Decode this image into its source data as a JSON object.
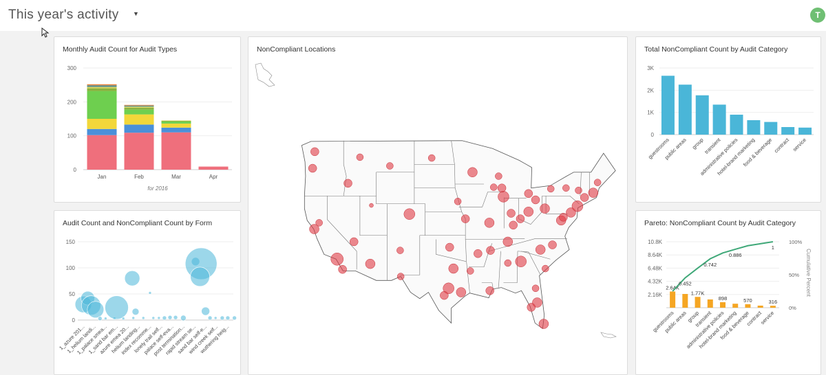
{
  "header": {
    "title": "This year's activity",
    "avatar_initial": "T"
  },
  "colors": {
    "pink": "#ef6f7c",
    "blue": "#4a90d9",
    "yellow": "#f2d73a",
    "green": "#6ecf4f",
    "olive": "#8bb23f",
    "orange_top": "#e8823a",
    "teal": "#4ab6d8",
    "pareto_bar": "#f5a623",
    "pareto_line": "#3fa878",
    "map_point": "#df3a44"
  },
  "cards": {
    "monthly": {
      "title": "Monthly Audit Count for Audit Types"
    },
    "map": {
      "title": "NonCompliant Locations"
    },
    "total": {
      "title": "Total NonCompliant Count by Audit Category"
    },
    "form": {
      "title": "Audit Count and NonCompliant Count by Form"
    },
    "pareto": {
      "title": "Pareto: NonCompliant Count by Audit Category"
    }
  },
  "chart_data": [
    {
      "id": "monthly",
      "type": "bar",
      "stacked": true,
      "categories": [
        "Jan",
        "Feb",
        "Mar",
        "Apr"
      ],
      "xlabel": "for 2016",
      "ylim": [
        0,
        300
      ],
      "yticks": [
        "0",
        "100",
        "200",
        "300"
      ],
      "grid": true,
      "series": [
        {
          "color": "#ef6f7c",
          "values": [
            102,
            109,
            110,
            9
          ]
        },
        {
          "color": "#4a90d9",
          "values": [
            18,
            24,
            14,
            0
          ]
        },
        {
          "color": "#f2d73a",
          "values": [
            30,
            30,
            12,
            0
          ]
        },
        {
          "color": "#6ecf4f",
          "values": [
            82,
            14,
            6,
            0
          ]
        },
        {
          "color": "#8bb23f",
          "values": [
            8,
            6,
            2,
            0
          ]
        },
        {
          "color": "#d8d45a",
          "values": [
            4,
            3,
            1,
            0
          ]
        },
        {
          "color": "#5a8f8f",
          "values": [
            5,
            3,
            0,
            0
          ]
        },
        {
          "color": "#e8823a",
          "values": [
            3,
            2,
            0,
            0
          ]
        }
      ]
    },
    {
      "id": "total",
      "type": "bar",
      "categories": [
        "guestrooms",
        "public areas",
        "group",
        "transient",
        "administrative policies",
        "hotel-brand marketing",
        "food & beverage",
        "contract",
        "service"
      ],
      "values": [
        2650,
        2250,
        1770,
        1350,
        898,
        650,
        570,
        340,
        316
      ],
      "ylim": [
        0,
        3000
      ],
      "yticks": [
        "0",
        "1K",
        "2K",
        "3K"
      ],
      "grid": true,
      "color": "#4ab6d8"
    },
    {
      "id": "form",
      "type": "scatter",
      "subtype": "bubble",
      "categories": [
        "1_azure 201...",
        "1_helium landi...",
        "1_palace smea...",
        "1_sand bar em...",
        "azure emea 20...",
        "helium landing...",
        "index recomme...",
        "lonely trail self...",
        "palace self-eva...",
        "post termination...",
        "rapid stream se...",
        "sand bar self-e...",
        "wind creek self...",
        "wuthering heig..."
      ],
      "ylim": [
        0,
        150
      ],
      "yticks": [
        "0",
        "50",
        "100",
        "150"
      ],
      "grid": true,
      "color": "#4ab6d8",
      "points": [
        {
          "x": 0.0,
          "y": 30,
          "r": 12
        },
        {
          "x": 0.4,
          "y": 42,
          "r": 10
        },
        {
          "x": 0.7,
          "y": 28,
          "r": 14
        },
        {
          "x": 1.1,
          "y": 20,
          "r": 12
        },
        {
          "x": 1.5,
          "y": 3,
          "r": 3
        },
        {
          "x": 2.0,
          "y": 3,
          "r": 2
        },
        {
          "x": 2.8,
          "y": 3,
          "r": 2
        },
        {
          "x": 3.0,
          "y": 24,
          "r": 17
        },
        {
          "x": 3.6,
          "y": 3,
          "r": 2
        },
        {
          "x": 4.4,
          "y": 80,
          "r": 11
        },
        {
          "x": 4.5,
          "y": 4,
          "r": 2
        },
        {
          "x": 4.7,
          "y": 16,
          "r": 5
        },
        {
          "x": 5.4,
          "y": 4,
          "r": 2
        },
        {
          "x": 6.0,
          "y": 52,
          "r": 2
        },
        {
          "x": 6.3,
          "y": 4,
          "r": 2
        },
        {
          "x": 6.8,
          "y": 4,
          "r": 2
        },
        {
          "x": 7.3,
          "y": 4,
          "r": 3
        },
        {
          "x": 7.8,
          "y": 5,
          "r": 3
        },
        {
          "x": 8.3,
          "y": 5,
          "r": 3
        },
        {
          "x": 9.0,
          "y": 4,
          "r": 4
        },
        {
          "x": 10.1,
          "y": 112,
          "r": 6
        },
        {
          "x": 10.6,
          "y": 108,
          "r": 23
        },
        {
          "x": 10.5,
          "y": 83,
          "r": 14
        },
        {
          "x": 11.0,
          "y": 17,
          "r": 6
        },
        {
          "x": 11.4,
          "y": 4,
          "r": 3
        },
        {
          "x": 11.9,
          "y": 4,
          "r": 2
        },
        {
          "x": 12.5,
          "y": 4,
          "r": 3
        },
        {
          "x": 13.0,
          "y": 4,
          "r": 3
        },
        {
          "x": 13.6,
          "y": 4,
          "r": 3
        }
      ]
    },
    {
      "id": "pareto",
      "type": "bar",
      "categories": [
        "guestrooms",
        "public areas",
        "group",
        "transient",
        "administrative policies",
        "hotel-brand marketing",
        "food & beverage",
        "contract",
        "service"
      ],
      "values": [
        2650,
        2250,
        1770,
        1350,
        898,
        650,
        570,
        340,
        316
      ],
      "bar_labels": [
        "2.64K",
        "",
        "1.77K",
        "",
        "898",
        "",
        "570",
        "",
        "316"
      ],
      "cumulative_percent": [
        0.25,
        0.452,
        0.6,
        0.742,
        0.83,
        0.886,
        0.94,
        0.97,
        1
      ],
      "cumulative_labels": [
        "",
        "0.452",
        "",
        "0.742",
        "",
        "0.886",
        "",
        "",
        "1"
      ],
      "ylim": [
        0,
        10800
      ],
      "yticks": [
        "2.16K",
        "4.32K",
        "6.48K",
        "8.64K",
        "10.8K"
      ],
      "y2ticks": [
        "0%",
        "50%",
        "100%"
      ],
      "y2label": "Cumulative Percent",
      "grid": true,
      "bar_color": "#f5a623",
      "line_color": "#3fa878"
    },
    {
      "id": "map",
      "type": "scatter",
      "subtype": "geo-points",
      "points": [
        {
          "lon": -122.4,
          "lat": 37.8,
          "r": 7
        },
        {
          "lon": -121.5,
          "lat": 38.6,
          "r": 5
        },
        {
          "lon": -118.2,
          "lat": 34.0,
          "r": 9
        },
        {
          "lon": -117.2,
          "lat": 32.7,
          "r": 6
        },
        {
          "lon": -122.7,
          "lat": 45.5,
          "r": 6
        },
        {
          "lon": -122.3,
          "lat": 47.6,
          "r": 6
        },
        {
          "lon": -116.2,
          "lat": 43.6,
          "r": 6
        },
        {
          "lon": -115.1,
          "lat": 36.2,
          "r": 6
        },
        {
          "lon": -112.1,
          "lat": 33.4,
          "r": 7
        },
        {
          "lon": -111.9,
          "lat": 40.8,
          "r": 3
        },
        {
          "lon": -104.9,
          "lat": 39.7,
          "r": 8
        },
        {
          "lon": -106.6,
          "lat": 35.1,
          "r": 5
        },
        {
          "lon": -97.7,
          "lat": 30.3,
          "r": 8
        },
        {
          "lon": -96.8,
          "lat": 32.8,
          "r": 7
        },
        {
          "lon": -95.4,
          "lat": 29.8,
          "r": 7
        },
        {
          "lon": -98.5,
          "lat": 29.4,
          "r": 6
        },
        {
          "lon": -97.5,
          "lat": 35.5,
          "r": 6
        },
        {
          "lon": -94.6,
          "lat": 39.1,
          "r": 6
        },
        {
          "lon": -90.2,
          "lat": 38.6,
          "r": 7
        },
        {
          "lon": -93.3,
          "lat": 45.0,
          "r": 7
        },
        {
          "lon": -87.6,
          "lat": 41.9,
          "r": 8
        },
        {
          "lon": -86.2,
          "lat": 39.8,
          "r": 6
        },
        {
          "lon": -84.5,
          "lat": 39.1,
          "r": 6
        },
        {
          "lon": -83.0,
          "lat": 42.3,
          "r": 6
        },
        {
          "lon": -81.7,
          "lat": 41.5,
          "r": 6
        },
        {
          "lon": -80.0,
          "lat": 40.4,
          "r": 7
        },
        {
          "lon": -77.0,
          "lat": 38.9,
          "r": 7
        },
        {
          "lon": -75.2,
          "lat": 39.9,
          "r": 7
        },
        {
          "lon": -74.0,
          "lat": 40.7,
          "r": 8
        },
        {
          "lon": -71.1,
          "lat": 42.4,
          "r": 7
        },
        {
          "lon": -73.8,
          "lat": 42.7,
          "r": 5
        },
        {
          "lon": -76.6,
          "lat": 39.3,
          "r": 6
        },
        {
          "lon": -80.8,
          "lat": 35.2,
          "r": 7
        },
        {
          "lon": -78.6,
          "lat": 35.8,
          "r": 6
        },
        {
          "lon": -84.4,
          "lat": 33.7,
          "r": 8
        },
        {
          "lon": -86.8,
          "lat": 36.2,
          "r": 7
        },
        {
          "lon": -90.0,
          "lat": 35.1,
          "r": 6
        },
        {
          "lon": -90.1,
          "lat": 30.0,
          "r": 6
        },
        {
          "lon": -86.8,
          "lat": 33.5,
          "r": 5
        },
        {
          "lon": -81.4,
          "lat": 28.5,
          "r": 7
        },
        {
          "lon": -80.2,
          "lat": 25.8,
          "r": 7
        },
        {
          "lon": -82.5,
          "lat": 27.9,
          "r": 6
        },
        {
          "lon": -81.7,
          "lat": 30.3,
          "r": 5
        },
        {
          "lon": -79.9,
          "lat": 32.8,
          "r": 5
        },
        {
          "lon": -85.8,
          "lat": 38.3,
          "r": 6
        },
        {
          "lon": -89.4,
          "lat": 43.1,
          "r": 5
        },
        {
          "lon": -87.9,
          "lat": 43.0,
          "r": 6
        },
        {
          "lon": -96.0,
          "lat": 41.3,
          "r": 5
        },
        {
          "lon": -92.3,
          "lat": 34.7,
          "r": 6
        },
        {
          "lon": -100.8,
          "lat": 46.8,
          "r": 5
        },
        {
          "lon": -88.5,
          "lat": 44.5,
          "r": 5
        },
        {
          "lon": -72.7,
          "lat": 41.8,
          "r": 6
        },
        {
          "lon": -93.7,
          "lat": 32.5,
          "r": 5
        },
        {
          "lon": -106.5,
          "lat": 31.8,
          "r": 5
        },
        {
          "lon": -114.0,
          "lat": 46.9,
          "r": 5
        },
        {
          "lon": -108.5,
          "lat": 45.8,
          "r": 5
        },
        {
          "lon": -83.0,
          "lat": 40.0,
          "r": 7
        },
        {
          "lon": -78.9,
          "lat": 42.9,
          "r": 5
        },
        {
          "lon": -76.1,
          "lat": 43.0,
          "r": 5
        },
        {
          "lon": -70.3,
          "lat": 43.7,
          "r": 5
        }
      ]
    }
  ]
}
